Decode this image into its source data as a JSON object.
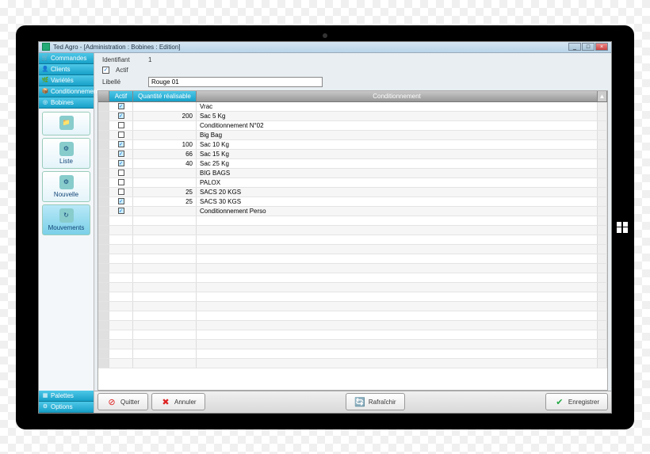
{
  "title": "Ted Agro - [Administration : Bobines : Edition]",
  "sidebar": {
    "nav": [
      {
        "label": "Commandes"
      },
      {
        "label": "Clients"
      },
      {
        "label": "Variétés"
      },
      {
        "label": "Conditionnements"
      },
      {
        "label": "Bobines"
      }
    ],
    "nav_bottom": [
      {
        "label": "Palettes"
      },
      {
        "label": "Options"
      }
    ],
    "tools": [
      {
        "label": ""
      },
      {
        "label": "Liste"
      },
      {
        "label": "Nouvelle"
      },
      {
        "label": "Mouvements"
      }
    ]
  },
  "form": {
    "id_label": "Identifiant",
    "id_value": "1",
    "active_label": "Actif",
    "libelle_label": "Libellé",
    "libelle_value": "Rouge 01"
  },
  "grid": {
    "headers": {
      "actif": "Actif",
      "qty": "Quantité réalisable",
      "cond": "Conditionnement"
    },
    "rows": [
      {
        "actif": true,
        "qty": "",
        "cond": "Vrac"
      },
      {
        "actif": true,
        "qty": "200",
        "cond": "Sac 5 Kg"
      },
      {
        "actif": false,
        "qty": "",
        "cond": "Conditionnement N°02"
      },
      {
        "actif": false,
        "qty": "",
        "cond": "Big Bag"
      },
      {
        "actif": true,
        "qty": "100",
        "cond": "Sac 10 Kg"
      },
      {
        "actif": true,
        "qty": "66",
        "cond": "Sac 15 Kg"
      },
      {
        "actif": true,
        "qty": "40",
        "cond": "Sac 25 Kg"
      },
      {
        "actif": false,
        "qty": "",
        "cond": "BIG BAGS"
      },
      {
        "actif": false,
        "qty": "",
        "cond": "PALOX"
      },
      {
        "actif": false,
        "qty": "25",
        "cond": "SACS 20 KGS"
      },
      {
        "actif": true,
        "qty": "25",
        "cond": "SACS 30 KGS"
      },
      {
        "actif": true,
        "qty": "",
        "cond": "Conditionnement Perso"
      }
    ]
  },
  "footer": {
    "quitter": "Quitter",
    "annuler": "Annuler",
    "rafraichir": "Rafraîchir",
    "enregistrer": "Enregistrer"
  }
}
